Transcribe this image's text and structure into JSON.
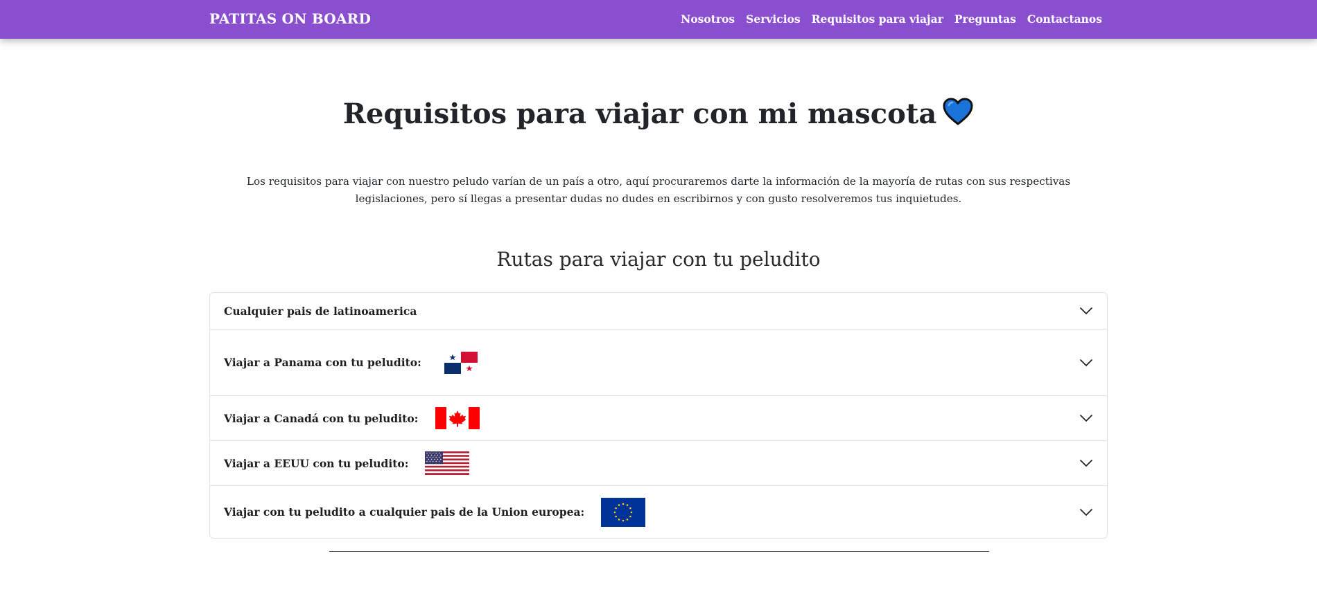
{
  "navbar": {
    "brand": "PATITAS ON BOARD",
    "links": [
      "Nosotros",
      "Servicios",
      "Requisitos para viajar",
      "Preguntas",
      "Contactanos"
    ],
    "background_color": "#8a4fcf"
  },
  "hero": {
    "title": "Requisitos para viajar con mi mascota",
    "title_icon": "blue-heart-icon",
    "intro": "Los requisitos para viajar con nuestro peludo varían de un país a otro, aquí procuraremos darte la información de la mayoría de rutas con sus respectivas legislaciones, pero sí llegas a presentar dudas no dudes en escribirnos y con gusto resolveremos tus inquietudes."
  },
  "routes": {
    "title": "Rutas para viajar con tu peludito",
    "items": [
      {
        "label": "Cualquier pais de latinoamerica",
        "flag": null,
        "expanded": false
      },
      {
        "label": "Viajar a Panama con tu peludito:",
        "flag": "panama-flag",
        "expanded": false
      },
      {
        "label": "Viajar a Canadá con tu peludito:",
        "flag": "canada-flag",
        "expanded": false
      },
      {
        "label": "Viajar a EEUU con tu peludito:",
        "flag": "usa-flag",
        "expanded": false
      },
      {
        "label": "Viajar con tu peludito a cualquier pais de la Union europea:",
        "flag": "eu-flag",
        "expanded": false
      }
    ]
  }
}
